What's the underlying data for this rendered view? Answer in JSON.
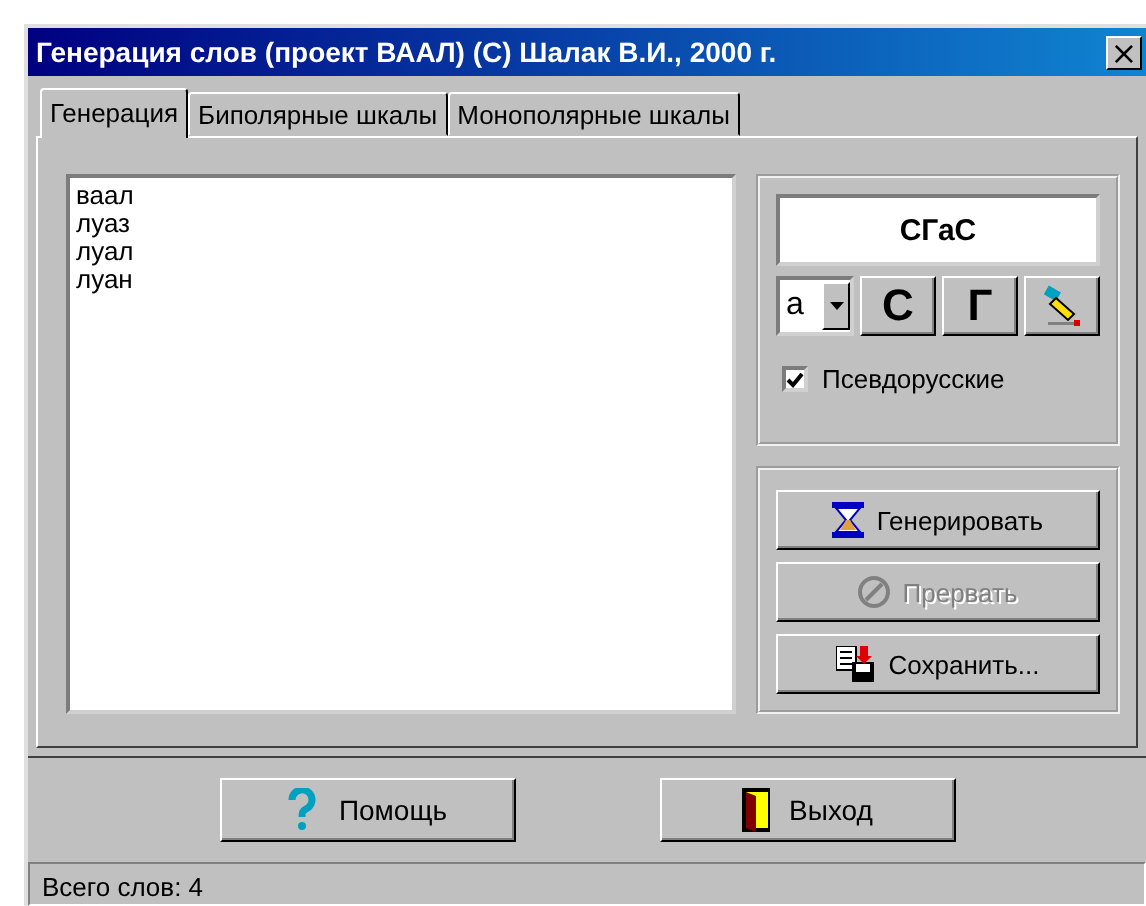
{
  "window": {
    "title": "Генерация слов (проект ВААЛ) (С) Шалак В.И., 2000 г.",
    "close": "×"
  },
  "tabs": [
    {
      "label": "Генерация",
      "selected": true
    },
    {
      "label": "Биполярные шкалы",
      "selected": false
    },
    {
      "label": "Монополярные шкалы",
      "selected": false
    }
  ],
  "words": [
    "ваал",
    "луаз",
    "луал",
    "луан"
  ],
  "pattern": {
    "value": "СГаС"
  },
  "letter_dropdown": {
    "value": "а"
  },
  "pattern_buttons": [
    {
      "label": "С",
      "kind": "text"
    },
    {
      "label": "Г",
      "kind": "text"
    },
    {
      "kind": "icon"
    }
  ],
  "pseudo_russian": {
    "label": "Псевдорусские",
    "checked": true
  },
  "actions": [
    {
      "label": "Генерировать",
      "kind": "generate",
      "disabled": false
    },
    {
      "label": "Прервать",
      "kind": "stop",
      "disabled": true
    },
    {
      "label": "Сохранить...",
      "kind": "save",
      "disabled": false
    }
  ],
  "bottom_buttons": [
    {
      "label": "Помощь",
      "kind": "help"
    },
    {
      "label": "Выход",
      "kind": "exit"
    }
  ],
  "status_bar": "Всего слов: 4"
}
